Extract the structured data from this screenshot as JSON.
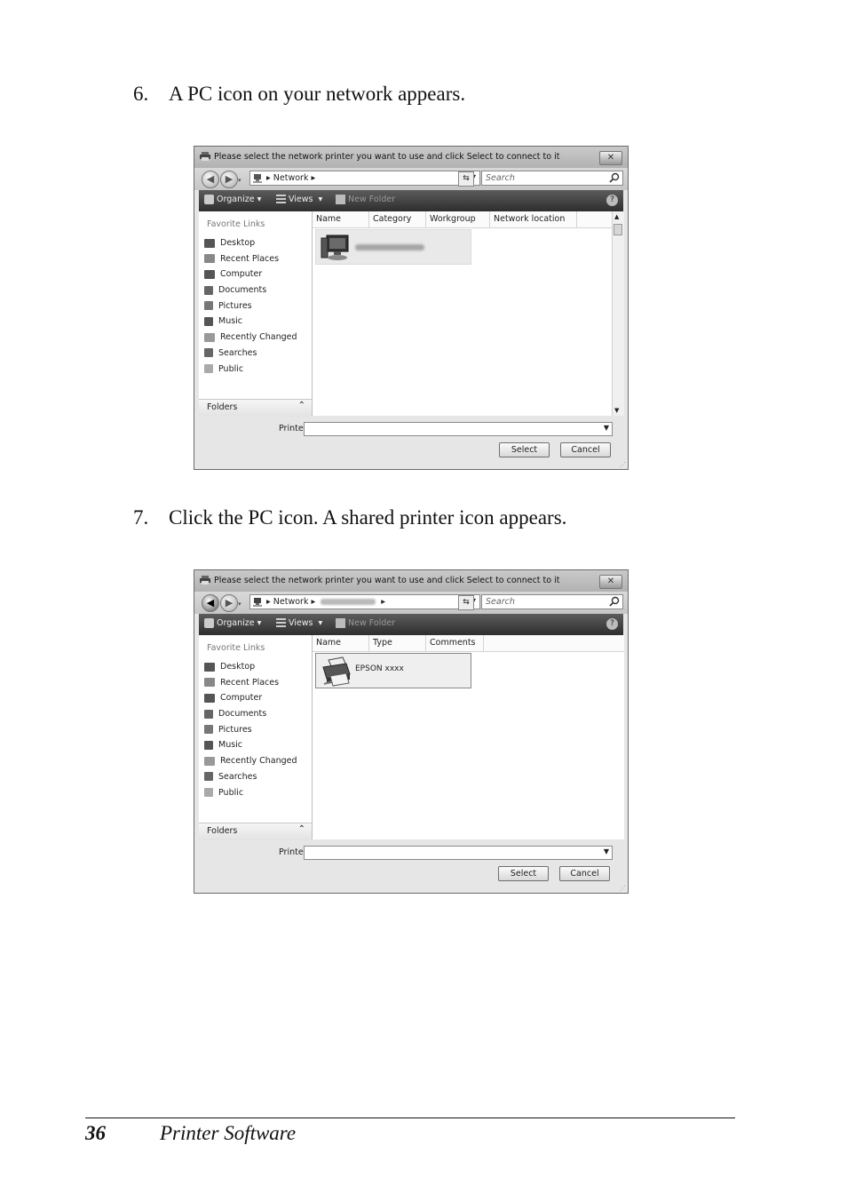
{
  "steps": [
    {
      "number": "6.",
      "text": "A PC icon on your network appears."
    },
    {
      "number": "7.",
      "text": "Click the PC icon. A shared printer icon appears."
    }
  ],
  "dialogs": [
    {
      "title": "Please select the network printer you want to use and click Select to connect to it",
      "close_label": "✕",
      "address": [
        "Network"
      ],
      "search_placeholder": "Search",
      "toolbar": {
        "organize": "Organize",
        "views": "Views",
        "new_folder": "New Folder"
      },
      "favorite_links_header": "Favorite Links",
      "favorite_links": [
        "Desktop",
        "Recent Places",
        "Computer",
        "Documents",
        "Pictures",
        "Music",
        "Recently Changed",
        "Searches",
        "Public"
      ],
      "folders_label": "Folders",
      "columns": [
        "Name",
        "Category",
        "Workgroup",
        "Network location"
      ],
      "printer_label": "Printer",
      "select_label": "Select",
      "cancel_label": "Cancel"
    },
    {
      "title": "Please select the network printer you want to use and click Select to connect to it",
      "close_label": "✕",
      "address": [
        "Network"
      ],
      "search_placeholder": "Search",
      "toolbar": {
        "organize": "Organize",
        "views": "Views",
        "new_folder": "New Folder"
      },
      "favorite_links_header": "Favorite Links",
      "favorite_links": [
        "Desktop",
        "Recent Places",
        "Computer",
        "Documents",
        "Pictures",
        "Music",
        "Recently Changed",
        "Searches",
        "Public"
      ],
      "folders_label": "Folders",
      "columns": [
        "Name",
        "Type",
        "Comments"
      ],
      "item_name": "EPSON xxxx",
      "printer_label": "Printer",
      "select_label": "Select",
      "cancel_label": "Cancel"
    }
  ],
  "footer": {
    "page_number": "36",
    "running_head": "Printer Software"
  }
}
